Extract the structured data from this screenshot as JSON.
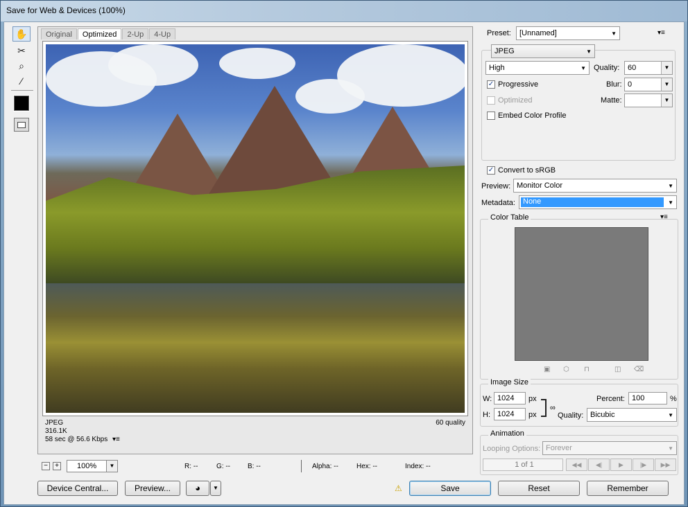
{
  "window": {
    "title": "Save for Web & Devices (100%)"
  },
  "tools": [
    {
      "name": "hand-tool-icon",
      "glyph": "✋"
    },
    {
      "name": "slice-select-tool-icon",
      "glyph": "✂"
    },
    {
      "name": "zoom-tool-icon",
      "glyph": "🔍"
    },
    {
      "name": "eyedropper-tool-icon",
      "glyph": "⁄"
    }
  ],
  "tabs": [
    "Original",
    "Optimized",
    "2-Up",
    "4-Up"
  ],
  "preview_info": {
    "format": "JPEG",
    "size": "316.1K",
    "time": "58 sec @ 56.6 Kbps",
    "quality": "60 quality"
  },
  "status": {
    "zoom": "100%",
    "r": "R: --",
    "g": "G: --",
    "b": "B: --",
    "alpha": "Alpha: --",
    "hex": "Hex: --",
    "index": "Index: --"
  },
  "buttons": {
    "device_central": "Device Central...",
    "preview": "Preview...",
    "save": "Save",
    "reset": "Reset",
    "remember": "Remember"
  },
  "settings": {
    "preset_label": "Preset:",
    "preset_value": "[Unnamed]",
    "format": "JPEG",
    "quality_level": "High",
    "quality_label": "Quality:",
    "quality_value": "60",
    "progressive_label": "Progressive",
    "blur_label": "Blur:",
    "blur_value": "0",
    "optimized_label": "Optimized",
    "matte_label": "Matte:",
    "embed_label": "Embed Color Profile",
    "convert_label": "Convert to sRGB",
    "preview_label": "Preview:",
    "preview_value": "Monitor Color",
    "metadata_label": "Metadata:",
    "metadata_value": "None"
  },
  "color_table": {
    "title": "Color Table"
  },
  "image_size": {
    "title": "Image Size",
    "w_label": "W:",
    "w_value": "1024",
    "h_label": "H:",
    "h_value": "1024",
    "unit": "px",
    "percent_label": "Percent:",
    "percent_value": "100",
    "percent_unit": "%",
    "quality_label": "Quality:",
    "quality_value": "Bicubic"
  },
  "animation": {
    "title": "Animation",
    "looping_label": "Looping Options:",
    "looping_value": "Forever",
    "frame_counter": "1 of 1"
  },
  "colors": {
    "accent": "#3399ff",
    "warning": "#c9a000"
  }
}
